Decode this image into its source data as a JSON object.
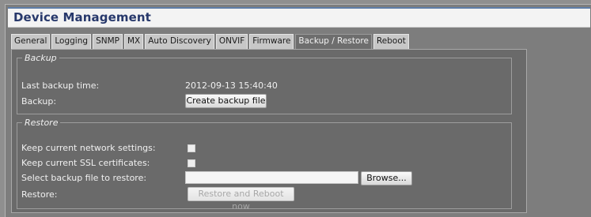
{
  "title": "Device Management",
  "tabs": [
    {
      "label": "General"
    },
    {
      "label": "Logging"
    },
    {
      "label": "SNMP"
    },
    {
      "label": "MX"
    },
    {
      "label": "Auto Discovery"
    },
    {
      "label": "ONVIF"
    },
    {
      "label": "Firmware"
    },
    {
      "label": "Backup / Restore",
      "active": true
    },
    {
      "label": "Reboot"
    }
  ],
  "backup": {
    "legend": "Backup",
    "last_backup_label": "Last backup time:",
    "last_backup_value": "2012-09-13 15:40:40",
    "backup_label": "Backup:",
    "create_button": "Create backup file"
  },
  "restore": {
    "legend": "Restore",
    "keep_network_label": "Keep current network settings:",
    "keep_ssl_label": "Keep current SSL certificates:",
    "select_file_label": "Select backup file to restore:",
    "file_value": "",
    "browse_button": "Browse...",
    "restore_label": "Restore:",
    "restore_button": "Restore and Reboot now",
    "keep_network_checked": false,
    "keep_ssl_checked": false
  }
}
